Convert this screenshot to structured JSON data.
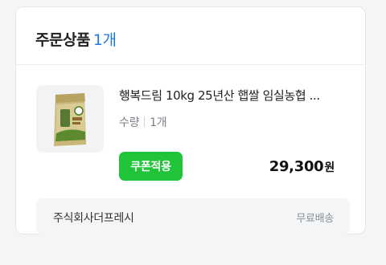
{
  "header": {
    "title": "주문상품",
    "count": "1개"
  },
  "item": {
    "name": "행복드림 10kg 25년산 햅쌀 임실농협 ...",
    "quantity_label": "수량",
    "quantity_value": "1개",
    "coupon_button": "쿠폰적용",
    "price": "29,300",
    "price_unit": "원",
    "thumbnail_icon": "rice-bag-icon"
  },
  "seller": {
    "name": "주식회사더프레시",
    "shipping": "무료배송"
  },
  "colors": {
    "accent": "#1f7ae0",
    "coupon": "#1fc439"
  }
}
